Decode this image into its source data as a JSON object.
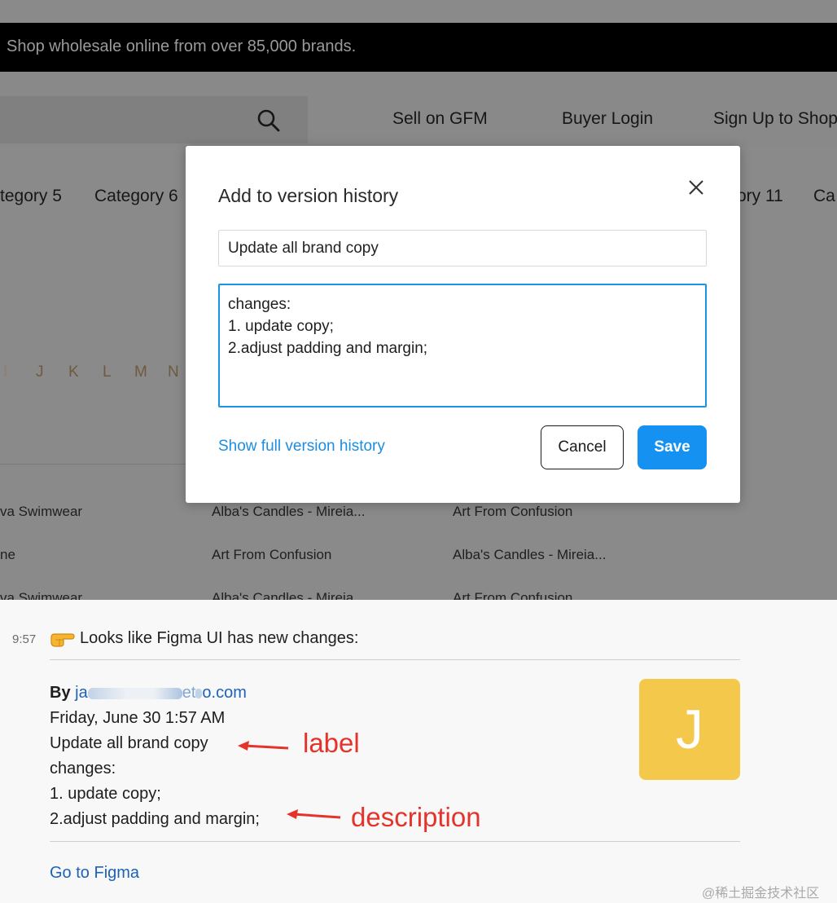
{
  "site": {
    "banner": "Shop wholesale online from over 85,000 brands.",
    "nav_links": [
      "Sell on GFM",
      "Buyer Login",
      "Sign Up to Shop"
    ],
    "categories_left": [
      "tegory 5",
      "Category 6"
    ],
    "categories_right": [
      "ory 11",
      "Ca"
    ],
    "alphabet": [
      "I",
      "J",
      "K",
      "L",
      "M",
      "N"
    ],
    "brands": [
      [
        "va Swimwear",
        "Alba's Candles - Mireia...",
        "Art From Confusion"
      ],
      [
        "ne",
        "Art From Confusion",
        "Alba's Candles - Mireia..."
      ],
      [
        "va Swimwear",
        "Alba's Candles - Mireia",
        "Art From Confusion"
      ]
    ]
  },
  "modal": {
    "title": "Add to version history",
    "label_value": "Update all brand copy",
    "description_value": "changes:\n1. update copy;\n2.adjust padding and margin;",
    "show_history_link": "Show full version history",
    "cancel_label": "Cancel",
    "save_label": "Save",
    "accent_color": "#1592f1"
  },
  "message": {
    "time": "9:57",
    "emoji": "point-right",
    "header": "Looks like Figma UI has new changes:",
    "by_label": "By",
    "email_start": "ja",
    "email_mid": "et",
    "email_end": "o.com",
    "date": "Friday, June 30 1:57 AM",
    "label": "Update all brand copy",
    "desc_line1": "changes:",
    "desc_line2": "1. update copy;",
    "desc_line3": "2.adjust padding and margin;",
    "avatar_letter": "J",
    "avatar_color": "#f3c84b",
    "link": "Go to Figma"
  },
  "annotations": {
    "label": "label",
    "description": "description"
  },
  "watermark": "@稀土掘金技术社区"
}
